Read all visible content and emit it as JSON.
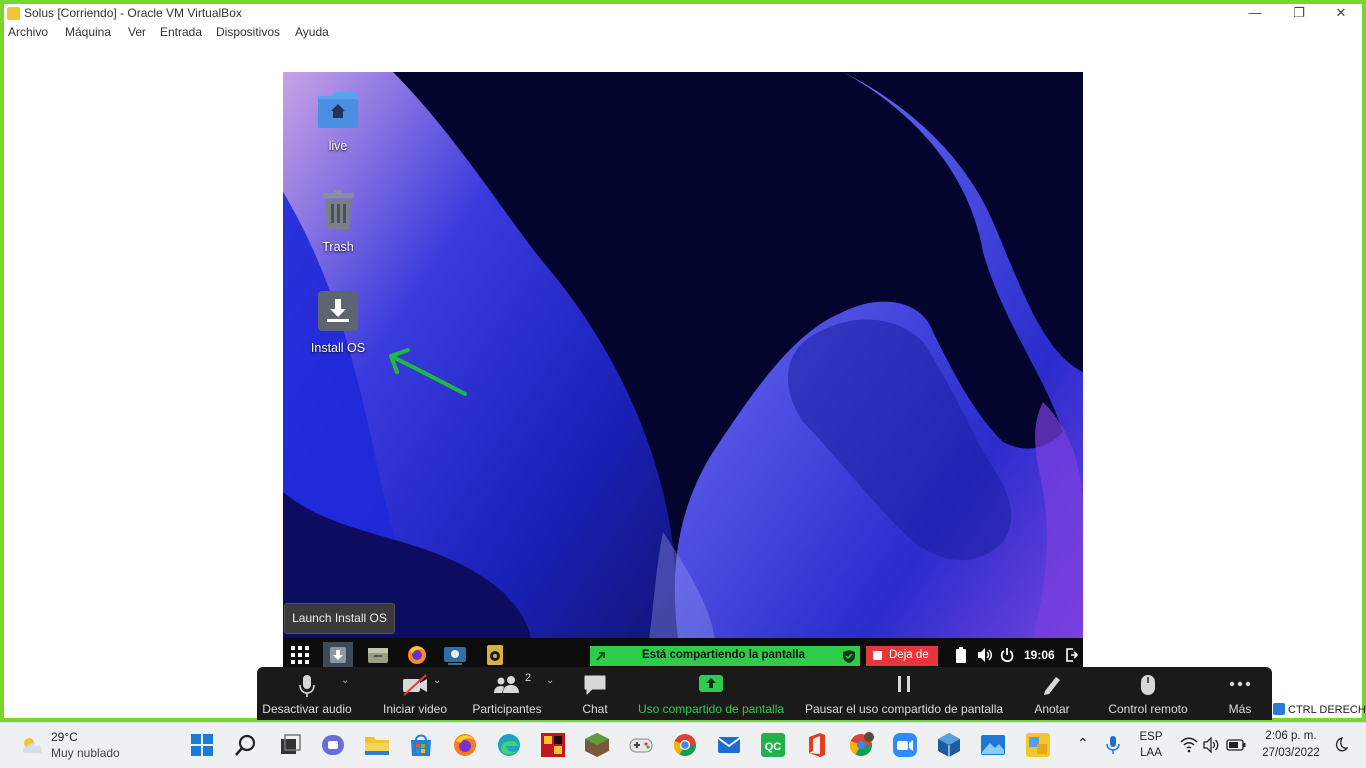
{
  "window": {
    "title": "Solus [Corriendo] - Oracle VM VirtualBox",
    "controls": {
      "minimize": "—",
      "maximize": "❐",
      "close": "✕"
    },
    "menu": [
      "Archivo",
      "Máquina",
      "Ver",
      "Entrada",
      "Dispositivos",
      "Ayuda"
    ]
  },
  "guest": {
    "desktop_icons": [
      {
        "label": "live",
        "icon": "home-folder-icon"
      },
      {
        "label": "Trash",
        "icon": "trash-icon"
      },
      {
        "label": "Install OS",
        "icon": "install-icon"
      }
    ],
    "tooltip": "Launch Install OS",
    "panel": {
      "share_status": "Está compartiendo la pantalla",
      "stop_label": "Deja de",
      "clock": "19:06"
    }
  },
  "zoom_toolbar": {
    "items": [
      {
        "label": "Desactivar audio",
        "icon": "microphone-icon"
      },
      {
        "label": "Iniciar video",
        "icon": "video-off-icon"
      },
      {
        "label": "Participantes",
        "icon": "participants-icon",
        "count": "2"
      },
      {
        "label": "Chat",
        "icon": "chat-icon"
      },
      {
        "label": "Uso compartido de pantalla",
        "icon": "share-screen-icon"
      },
      {
        "label": "Pausar el uso compartido de pantalla",
        "icon": "pause-icon"
      },
      {
        "label": "Anotar",
        "icon": "pencil-icon"
      },
      {
        "label": "Control remoto",
        "icon": "mouse-icon"
      },
      {
        "label": "Más",
        "icon": "more-icon"
      }
    ],
    "accent": "#2fcb4a",
    "host_key": "CTRL DERECHA"
  },
  "taskbar": {
    "weather": {
      "temp": "29°C",
      "desc": "Muy nublado"
    },
    "language": {
      "lang": "ESP",
      "layout": "LAA"
    },
    "time": "2:06 p. m.",
    "date": "27/03/2022",
    "apps": [
      "start-icon",
      "search-icon",
      "task-view-icon",
      "teams-icon",
      "file-explorer-icon",
      "store-icon",
      "firefox-icon",
      "edge-icon",
      "app-icon",
      "minecraft-icon",
      "controller-icon",
      "chrome-icon",
      "mail-icon",
      "qc-icon",
      "office-icon",
      "chrome-profile-icon",
      "zoom-icon",
      "virtualbox-icon",
      "photos-icon",
      "vm-icon"
    ]
  }
}
